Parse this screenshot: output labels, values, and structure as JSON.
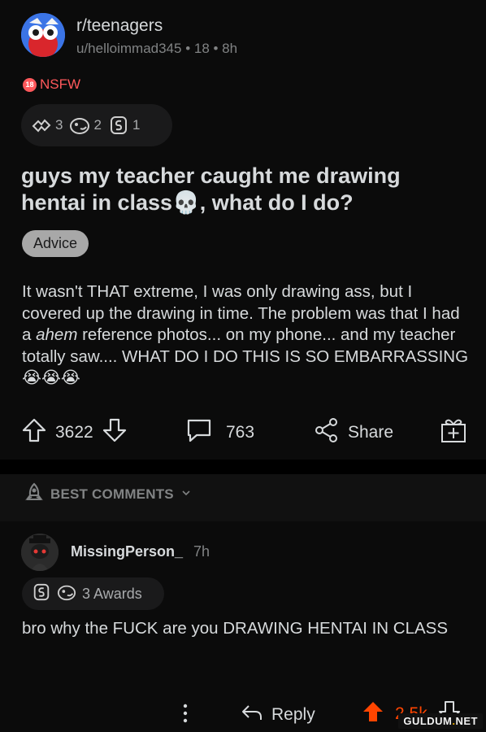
{
  "post": {
    "subreddit": "r/teenagers",
    "meta": "u/helloimmad345 • 18 • 8h",
    "nsfw_label": "NSFW",
    "nsfw_badge": "18",
    "awards": [
      {
        "icon": "wholesome-award-icon",
        "count": "3"
      },
      {
        "icon": "silly-award-icon",
        "count": "2"
      },
      {
        "icon": "silver-award-icon",
        "count": "1"
      }
    ],
    "title": "guys my teacher caught me drawing hentai in class💀, what do I do?",
    "flair": "Advice",
    "body_part1": "It wasn't THAT extreme, I was only drawing ass, but I covered up the drawing in time. The problem was that I had a ",
    "body_emph": "ahem",
    "body_part2": " reference photos... on my phone... and my teacher totally saw.... WHAT DO I DO THIS IS SO EMBARRASSING 😭😭😭",
    "votes": "3622",
    "comments": "763",
    "share_label": "Share"
  },
  "section": {
    "best_comments_label": "BEST COMMENTS"
  },
  "comment": {
    "username": "MissingPerson_",
    "time": "7h",
    "awards_label": "3 Awards",
    "text": "bro why the FUCK are you DRAWING HENTAI IN CLASS",
    "reply_label": "Reply",
    "score": "2.5k"
  },
  "watermark": {
    "left": "GULDUM",
    "dot": ".",
    "right": "NET"
  },
  "colors": {
    "nsfw": "#ff585b",
    "upvoted": "#ff4500",
    "text": "#d7dadc",
    "muted": "#818384"
  }
}
